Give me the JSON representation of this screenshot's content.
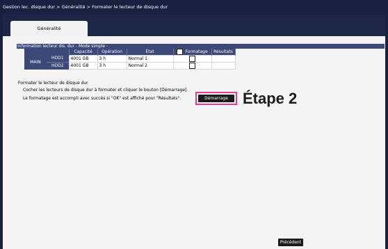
{
  "breadcrumb": "Gestion lec. disque dur > Généralité > Formater le lecteur de disque dur",
  "tabs": [
    {
      "label": "Généralité"
    }
  ],
  "info_section": {
    "title": "Information lecteur dis. dur - Mode simple -",
    "columns": {
      "capacity": "Capacité",
      "operation": "Opération",
      "state": "État",
      "format": "Formatage",
      "results": "Résultats"
    },
    "group_label": "MAIN",
    "rows": [
      {
        "hdd": "HDD1",
        "capacity": "4001 GB",
        "operation": "3 h",
        "state": "Normal 1",
        "format_checked": false,
        "result": ""
      },
      {
        "hdd": "HDD2",
        "capacity": "4001 GB",
        "operation": "3 h",
        "state": "Normal 2",
        "format_checked": false,
        "result": ""
      }
    ]
  },
  "format_section": {
    "title": "Formater le lecteur de disque dur",
    "line1": "Cocher les lecteurs de disque dur à formater et cliquer le bouton [Démarrage].",
    "line2": "Le formatage est accompli avec succès si \"OK\" est affiché pour \"Résultats\".",
    "start_button": "Démarrage"
  },
  "step_label": "Étape 2",
  "prev_button": "Précédent",
  "colors": {
    "background": "#1a2140",
    "panel": "#f4f4f4",
    "header": "#3b4878",
    "highlight": "#e83b8f",
    "button": "#1a1a1a"
  }
}
